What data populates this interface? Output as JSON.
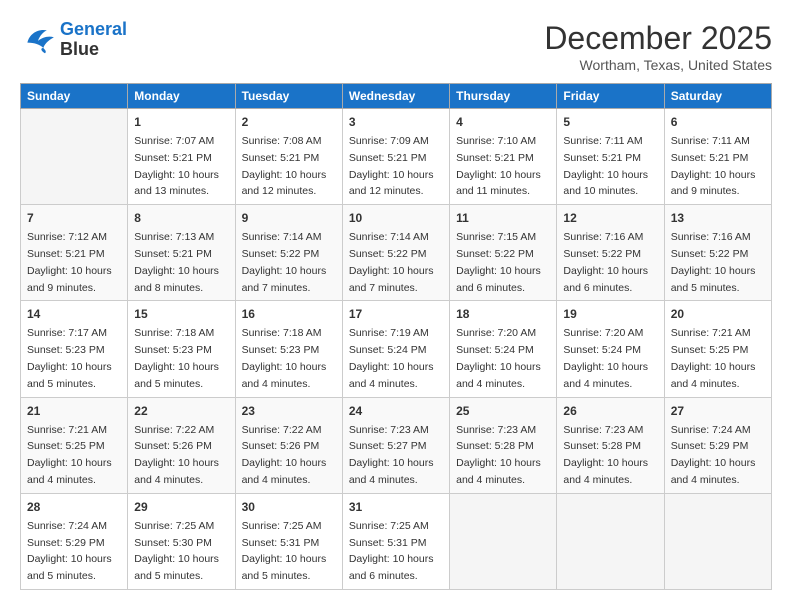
{
  "header": {
    "logo_line1": "General",
    "logo_line2": "Blue",
    "month_title": "December 2025",
    "location": "Wortham, Texas, United States"
  },
  "weekdays": [
    "Sunday",
    "Monday",
    "Tuesday",
    "Wednesday",
    "Thursday",
    "Friday",
    "Saturday"
  ],
  "weeks": [
    [
      {
        "day": "",
        "info": ""
      },
      {
        "day": "1",
        "info": "Sunrise: 7:07 AM\nSunset: 5:21 PM\nDaylight: 10 hours\nand 13 minutes."
      },
      {
        "day": "2",
        "info": "Sunrise: 7:08 AM\nSunset: 5:21 PM\nDaylight: 10 hours\nand 12 minutes."
      },
      {
        "day": "3",
        "info": "Sunrise: 7:09 AM\nSunset: 5:21 PM\nDaylight: 10 hours\nand 12 minutes."
      },
      {
        "day": "4",
        "info": "Sunrise: 7:10 AM\nSunset: 5:21 PM\nDaylight: 10 hours\nand 11 minutes."
      },
      {
        "day": "5",
        "info": "Sunrise: 7:11 AM\nSunset: 5:21 PM\nDaylight: 10 hours\nand 10 minutes."
      },
      {
        "day": "6",
        "info": "Sunrise: 7:11 AM\nSunset: 5:21 PM\nDaylight: 10 hours\nand 9 minutes."
      }
    ],
    [
      {
        "day": "7",
        "info": "Sunrise: 7:12 AM\nSunset: 5:21 PM\nDaylight: 10 hours\nand 9 minutes."
      },
      {
        "day": "8",
        "info": "Sunrise: 7:13 AM\nSunset: 5:21 PM\nDaylight: 10 hours\nand 8 minutes."
      },
      {
        "day": "9",
        "info": "Sunrise: 7:14 AM\nSunset: 5:22 PM\nDaylight: 10 hours\nand 7 minutes."
      },
      {
        "day": "10",
        "info": "Sunrise: 7:14 AM\nSunset: 5:22 PM\nDaylight: 10 hours\nand 7 minutes."
      },
      {
        "day": "11",
        "info": "Sunrise: 7:15 AM\nSunset: 5:22 PM\nDaylight: 10 hours\nand 6 minutes."
      },
      {
        "day": "12",
        "info": "Sunrise: 7:16 AM\nSunset: 5:22 PM\nDaylight: 10 hours\nand 6 minutes."
      },
      {
        "day": "13",
        "info": "Sunrise: 7:16 AM\nSunset: 5:22 PM\nDaylight: 10 hours\nand 5 minutes."
      }
    ],
    [
      {
        "day": "14",
        "info": "Sunrise: 7:17 AM\nSunset: 5:23 PM\nDaylight: 10 hours\nand 5 minutes."
      },
      {
        "day": "15",
        "info": "Sunrise: 7:18 AM\nSunset: 5:23 PM\nDaylight: 10 hours\nand 5 minutes."
      },
      {
        "day": "16",
        "info": "Sunrise: 7:18 AM\nSunset: 5:23 PM\nDaylight: 10 hours\nand 4 minutes."
      },
      {
        "day": "17",
        "info": "Sunrise: 7:19 AM\nSunset: 5:24 PM\nDaylight: 10 hours\nand 4 minutes."
      },
      {
        "day": "18",
        "info": "Sunrise: 7:20 AM\nSunset: 5:24 PM\nDaylight: 10 hours\nand 4 minutes."
      },
      {
        "day": "19",
        "info": "Sunrise: 7:20 AM\nSunset: 5:24 PM\nDaylight: 10 hours\nand 4 minutes."
      },
      {
        "day": "20",
        "info": "Sunrise: 7:21 AM\nSunset: 5:25 PM\nDaylight: 10 hours\nand 4 minutes."
      }
    ],
    [
      {
        "day": "21",
        "info": "Sunrise: 7:21 AM\nSunset: 5:25 PM\nDaylight: 10 hours\nand 4 minutes."
      },
      {
        "day": "22",
        "info": "Sunrise: 7:22 AM\nSunset: 5:26 PM\nDaylight: 10 hours\nand 4 minutes."
      },
      {
        "day": "23",
        "info": "Sunrise: 7:22 AM\nSunset: 5:26 PM\nDaylight: 10 hours\nand 4 minutes."
      },
      {
        "day": "24",
        "info": "Sunrise: 7:23 AM\nSunset: 5:27 PM\nDaylight: 10 hours\nand 4 minutes."
      },
      {
        "day": "25",
        "info": "Sunrise: 7:23 AM\nSunset: 5:28 PM\nDaylight: 10 hours\nand 4 minutes."
      },
      {
        "day": "26",
        "info": "Sunrise: 7:23 AM\nSunset: 5:28 PM\nDaylight: 10 hours\nand 4 minutes."
      },
      {
        "day": "27",
        "info": "Sunrise: 7:24 AM\nSunset: 5:29 PM\nDaylight: 10 hours\nand 4 minutes."
      }
    ],
    [
      {
        "day": "28",
        "info": "Sunrise: 7:24 AM\nSunset: 5:29 PM\nDaylight: 10 hours\nand 5 minutes."
      },
      {
        "day": "29",
        "info": "Sunrise: 7:25 AM\nSunset: 5:30 PM\nDaylight: 10 hours\nand 5 minutes."
      },
      {
        "day": "30",
        "info": "Sunrise: 7:25 AM\nSunset: 5:31 PM\nDaylight: 10 hours\nand 5 minutes."
      },
      {
        "day": "31",
        "info": "Sunrise: 7:25 AM\nSunset: 5:31 PM\nDaylight: 10 hours\nand 6 minutes."
      },
      {
        "day": "",
        "info": ""
      },
      {
        "day": "",
        "info": ""
      },
      {
        "day": "",
        "info": ""
      }
    ]
  ]
}
